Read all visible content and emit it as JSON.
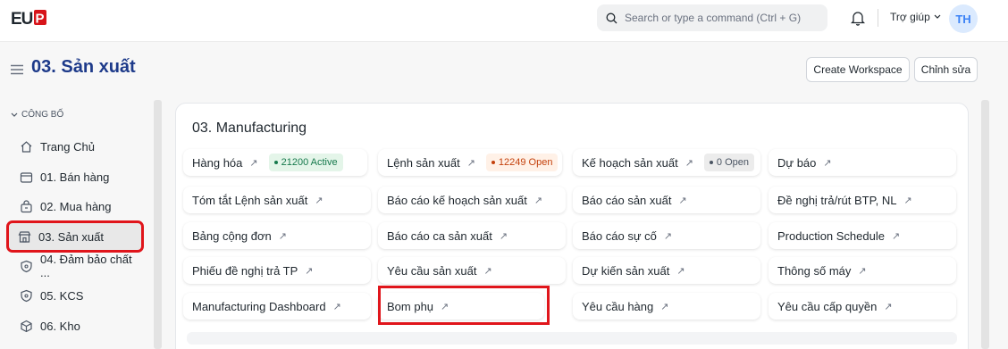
{
  "app": {
    "logo_text": "EUP",
    "search_placeholder": "Search or type a command (Ctrl + G)",
    "help_label": "Trợ giúp",
    "user_initials": "TH"
  },
  "header": {
    "title": "03. Sản xuất",
    "create_workspace_label": "Create Workspace",
    "edit_label": "Chỉnh sửa"
  },
  "sidebar": {
    "section_label": "CÔNG BỐ",
    "items": [
      {
        "label": "Trang Chủ",
        "icon": "home-icon"
      },
      {
        "label": "01. Bán hàng",
        "icon": "wallet-icon"
      },
      {
        "label": "02. Mua hàng",
        "icon": "bag-icon"
      },
      {
        "label": "03. Sản xuất",
        "icon": "store-icon",
        "active": true
      },
      {
        "label": "04. Đảm bảo chất ...",
        "icon": "shield-icon"
      },
      {
        "label": "05. KCS",
        "icon": "shield-icon"
      },
      {
        "label": "06. Kho",
        "icon": "box-icon"
      }
    ]
  },
  "main": {
    "card_title": "03. Manufacturing",
    "links": [
      {
        "label": "Hàng hóa",
        "badge": "21200 Active",
        "badge_color": "green"
      },
      {
        "label": "Lệnh sản xuất",
        "badge": "12249 Open",
        "badge_color": "orange"
      },
      {
        "label": "Kế hoạch sản xuất",
        "badge": "0 Open",
        "badge_color": "gray"
      },
      {
        "label": "Dự báo"
      },
      {
        "label": "Tóm tắt Lệnh sản xuất"
      },
      {
        "label": "Báo cáo kế hoạch sản xuất"
      },
      {
        "label": "Báo cáo sản xuất"
      },
      {
        "label": "Đề nghị trả/rút BTP, NL"
      },
      {
        "label": "Bảng cộng đơn"
      },
      {
        "label": "Báo cáo ca sản xuất"
      },
      {
        "label": "Báo cáo sự cố"
      },
      {
        "label": "Production Schedule"
      },
      {
        "label": "Phiếu đề nghị trả TP"
      },
      {
        "label": "Yêu cầu sản xuất"
      },
      {
        "label": "Dự kiến sản xuất"
      },
      {
        "label": "Thông số máy"
      },
      {
        "label": "Manufacturing Dashboard"
      },
      {
        "label": "Bom phụ"
      },
      {
        "label": "Yêu cầu hàng"
      },
      {
        "label": "Yêu cầu cấp quyền"
      }
    ]
  },
  "colors": {
    "accent": "#1d3a8a",
    "highlight": "#e0151b",
    "logo_red": "#d7141a"
  }
}
